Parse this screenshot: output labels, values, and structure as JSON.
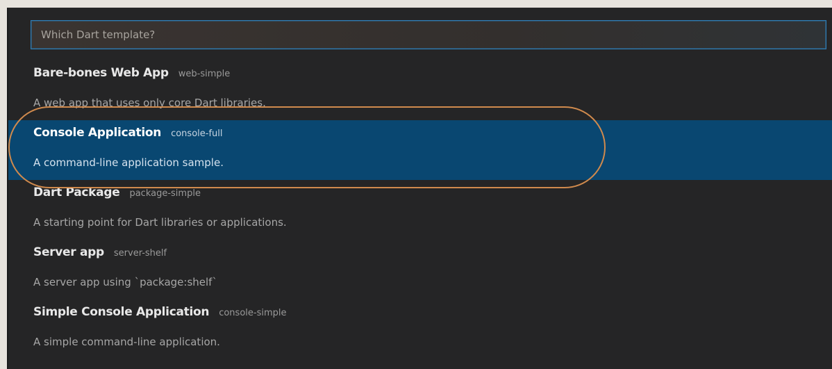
{
  "search": {
    "placeholder": "Which Dart template?"
  },
  "items": [
    {
      "label": "Bare-bones Web App",
      "detail": "web-simple",
      "description": "A web app that uses only core Dart libraries."
    },
    {
      "label": "Console Application",
      "detail": "console-full",
      "description": "A command-line application sample."
    },
    {
      "label": "Dart Package",
      "detail": "package-simple",
      "description": "A starting point for Dart libraries or applications."
    },
    {
      "label": "Server app",
      "detail": "server-shelf",
      "description": "A server app using `package:shelf`"
    },
    {
      "label": "Simple Console Application",
      "detail": "console-simple",
      "description": "A simple command-line application."
    }
  ],
  "colors": {
    "background": "#252526",
    "selection": "#094771",
    "focus_border": "#2f7fb8",
    "annotation_outline": "#d08a4d"
  }
}
